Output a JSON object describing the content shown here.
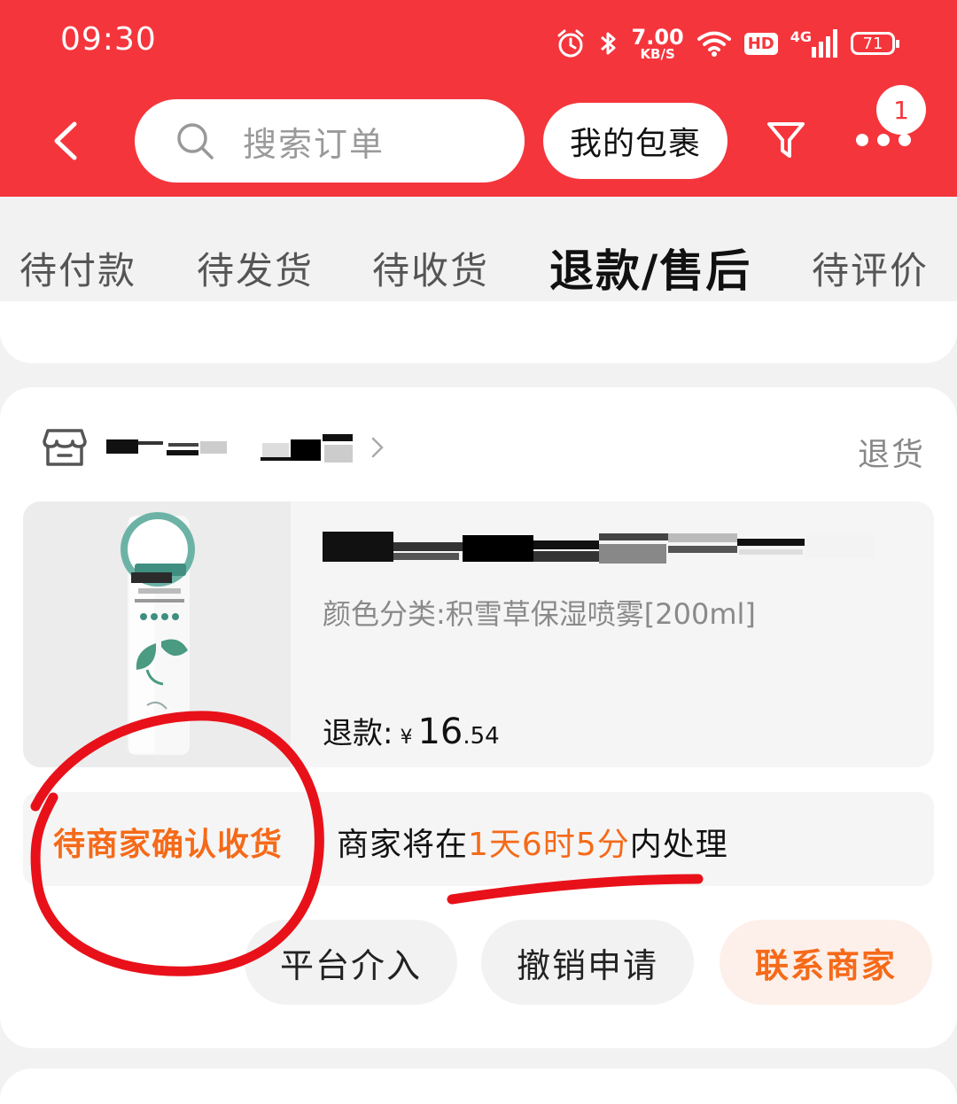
{
  "status_bar": {
    "time": "09:30",
    "net_speed_value": "7.00",
    "net_speed_unit": "KB/S",
    "hd_label": "HD",
    "network_label": "4G",
    "battery_level": "71",
    "icons": [
      "alarm-icon",
      "bluetooth-icon",
      "wifi-icon",
      "signal-icon",
      "battery-icon"
    ]
  },
  "header": {
    "search_placeholder": "搜索订单",
    "my_packages_label": "我的包裹",
    "more_badge_count": "1",
    "icons": [
      "back-arrow-icon",
      "search-icon",
      "filter-icon",
      "more-dots-icon"
    ]
  },
  "tabs": [
    {
      "label": "待付款",
      "active": false
    },
    {
      "label": "待发货",
      "active": false
    },
    {
      "label": "待收货",
      "active": false
    },
    {
      "label": "退款/售后",
      "active": true
    },
    {
      "label": "待评价",
      "active": false
    }
  ],
  "order": {
    "refund_type": "退货",
    "product": {
      "spec": "颜色分类:积雪草保湿喷雾[200ml]",
      "refund_label": "退款:",
      "currency": "¥",
      "amount_int": "16",
      "amount_dec": ".54"
    },
    "status": {
      "title": "待商家确认收货",
      "desc_prefix": "商家将在",
      "desc_highlight": "1天6时5分",
      "desc_suffix": "内处理"
    },
    "actions": [
      {
        "label": "平台介入",
        "primary": false
      },
      {
        "label": "撤销申请",
        "primary": false
      },
      {
        "label": "联系商家",
        "primary": true
      }
    ]
  },
  "colors": {
    "header_red": "#f5353c",
    "accent_orange": "#f56a19",
    "annotation_red": "#e8111a"
  }
}
